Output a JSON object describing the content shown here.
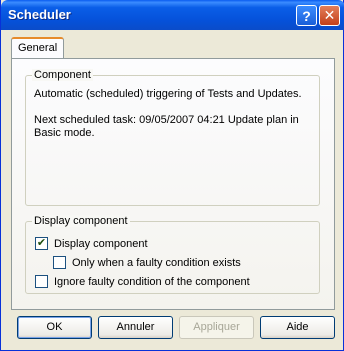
{
  "window": {
    "title": "Scheduler"
  },
  "titlebar": {
    "help_glyph": "?",
    "close_glyph": "✕"
  },
  "tabs": [
    {
      "label": "General"
    }
  ],
  "component": {
    "group_label": "Component",
    "description": "Automatic (scheduled) triggering of Tests and Updates.",
    "next_task_line1": "Next scheduled task: 09/05/2007 04:21 Update plan in",
    "next_task_line2": "Basic mode."
  },
  "display": {
    "group_label": "Display component",
    "options": [
      {
        "label": "Display component",
        "checked": true
      },
      {
        "label": "Only when a faulty condition exists",
        "checked": false
      },
      {
        "label": "Ignore faulty condition of the component",
        "checked": false
      }
    ]
  },
  "buttons": {
    "ok": "OK",
    "cancel": "Annuler",
    "apply": "Appliquer",
    "help": "Aide"
  }
}
